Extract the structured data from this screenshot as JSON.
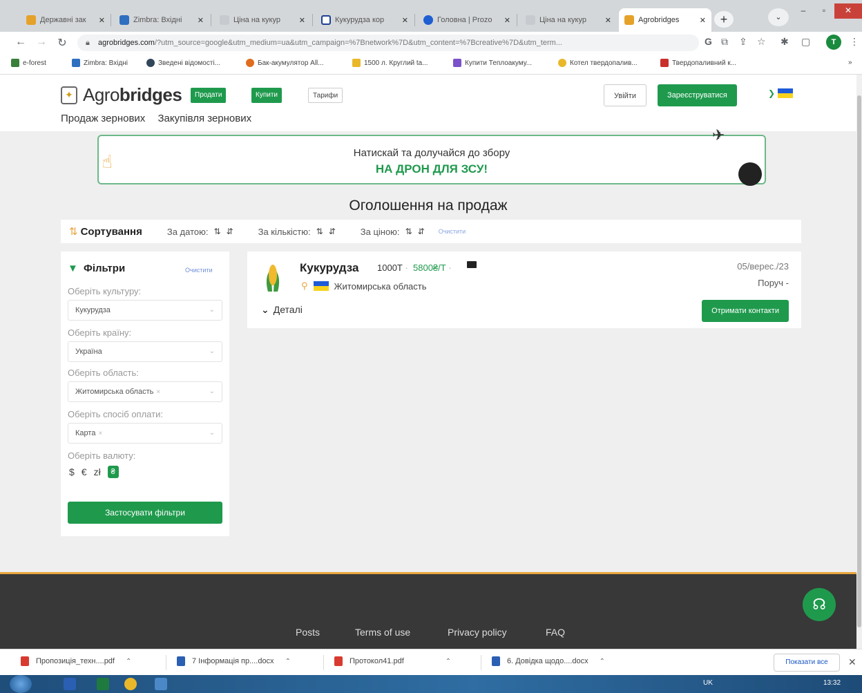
{
  "browser": {
    "tabs": [
      {
        "title": "Державні зак"
      },
      {
        "title": "Zimbra: Вхідні"
      },
      {
        "title": "Ціна на кукур"
      },
      {
        "title": "Кукурудза кор"
      },
      {
        "title": "Головна | Prozo"
      },
      {
        "title": "Ціна на кукур"
      },
      {
        "title": "Agrobridges"
      }
    ],
    "new_tab": "+",
    "url_host": "agrobridges.com",
    "url_rest": "/?utm_source=google&utm_medium=ua&utm_campaign=%7Bnetwork%7D&utm_content=%7Bcreative%7D&utm_term...",
    "profile_letter": "T",
    "bookmarks": [
      {
        "label": "e-forest"
      },
      {
        "label": "Zimbra: Вхідні"
      },
      {
        "label": "Зведені відомості..."
      },
      {
        "label": "Бак-акумулятор All..."
      },
      {
        "label": "1500 л. Круглий ta..."
      },
      {
        "label": "Купити Теплоакуму..."
      },
      {
        "label": "Котел твердопалив..."
      },
      {
        "label": "Твердопаливний к..."
      }
    ]
  },
  "header": {
    "logo_prefix": "Agro",
    "logo_suffix": "bridges",
    "btn_sell": "Продати",
    "btn_buy": "Купити",
    "btn_tariffs": "Тарифи",
    "btn_login": "Увійти",
    "btn_register": "Зареєструватися",
    "subnav": [
      "Продаж зернових",
      "Закупівля зернових"
    ]
  },
  "banner": {
    "line1": "Натискай та долучайся до збору",
    "line2": "НА ДРОН ДЛЯ ЗСУ!"
  },
  "page_title": "Оголошення на продаж",
  "sort": {
    "heading": "Сортування",
    "by_date": "За датою:",
    "by_quantity": "За кількістю:",
    "by_price": "За ціною:",
    "clear": "Очистити"
  },
  "filters": {
    "heading": "Фільтри",
    "clear": "Очистити",
    "crop_label": "Оберіть культуру:",
    "crop_value": "Кукурудза",
    "country_label": "Оберіть країну:",
    "country_value": "Україна",
    "region_label": "Оберіть область:",
    "region_value": "Житомирська область",
    "payment_label": "Оберіть спосіб оплати:",
    "payment_value": "Карта",
    "currency_label": "Оберіть валюту:",
    "currencies": [
      "$",
      "€",
      "zł",
      "₴"
    ],
    "apply": "Застосувати фільтри"
  },
  "listing": {
    "crop": "Кукурудза",
    "quantity": "1000Т",
    "price": "5800₴/Т",
    "region": "Житомирська область",
    "date": "05/верес./23",
    "status": "Поруч -",
    "details": "Деталі",
    "contacts_btn": "Отримати контакти"
  },
  "footer": {
    "links": [
      "Posts",
      "Terms of use",
      "Privacy policy",
      "FAQ"
    ]
  },
  "downloads": {
    "items": [
      {
        "name": "Пропозиція_техн....pdf"
      },
      {
        "name": "7 Інформація пр....docx"
      },
      {
        "name": "Протокол41.pdf"
      },
      {
        "name": "6. Довідка щодо....docx"
      }
    ],
    "show_all": "Показати все"
  },
  "taskbar": {
    "tray": "UK",
    "clock": "13:32"
  }
}
